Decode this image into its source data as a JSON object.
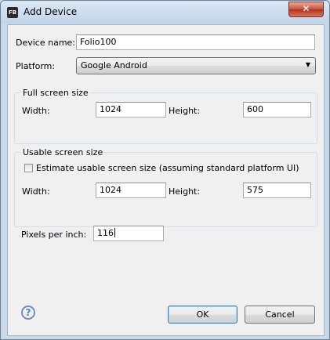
{
  "window": {
    "title": "Add Device",
    "app_icon_text": "FB",
    "close_glyph": "✕"
  },
  "form": {
    "device_name_label": "Device name:",
    "device_name_value": "Folio100",
    "platform_label": "Platform:",
    "platform_value": "Google Android",
    "full_screen": {
      "title": "Full screen size",
      "width_label": "Width:",
      "width_value": "1024",
      "height_label": "Height:",
      "height_value": "600"
    },
    "usable_screen": {
      "title": "Usable screen size",
      "estimate_label": "Estimate usable screen size (assuming standard platform UI)",
      "estimate_checked": false,
      "width_label": "Width:",
      "width_value": "1024",
      "height_label": "Height:",
      "height_value": "575"
    },
    "ppi_label": "Pixels per inch:",
    "ppi_value": "116"
  },
  "buttons": {
    "help_glyph": "?",
    "ok_label": "OK",
    "cancel_label": "Cancel"
  }
}
